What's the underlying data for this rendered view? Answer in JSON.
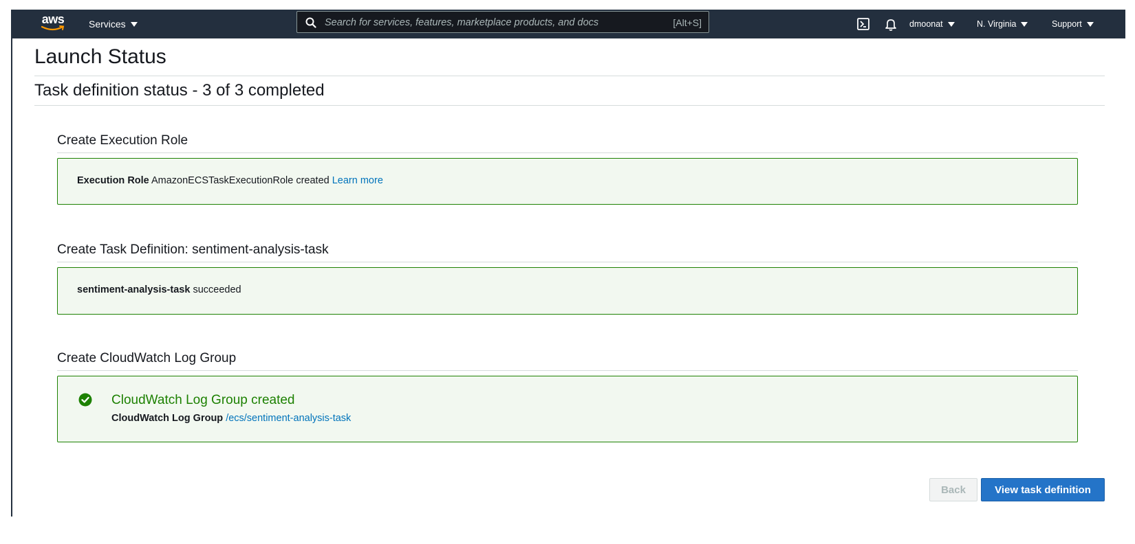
{
  "nav": {
    "logo_text": "aws",
    "services_label": "Services",
    "search_placeholder": "Search for services, features, marketplace products, and docs",
    "search_shortcut": "[Alt+S]",
    "user_label": "dmoonat",
    "region_label": "N. Virginia",
    "support_label": "Support",
    "icons": [
      "cloudshell-icon",
      "bell-icon",
      "search-icon",
      "caret-down-icon"
    ]
  },
  "page": {
    "title": "Launch Status",
    "subtitle": "Task definition status - 3 of 3 completed"
  },
  "sections": [
    {
      "title": "Create Execution Role",
      "label": "Execution Role",
      "text": "AmazonECSTaskExecutionRole created",
      "link": "Learn more"
    },
    {
      "title": "Create Task Definition: sentiment-analysis-task",
      "label": "sentiment-analysis-task",
      "text": "succeeded"
    },
    {
      "title": "Create CloudWatch Log Group",
      "success_title": "CloudWatch Log Group created",
      "label": "CloudWatch Log Group",
      "link": "/ecs/sentiment-analysis-task",
      "icon": "check-circle-icon"
    }
  ],
  "actions": {
    "back_label": "Back",
    "primary_label": "View task definition"
  },
  "colors": {
    "nav_bg": "#232f3e",
    "success": "#1d8102",
    "link": "#0073bb",
    "primary_button": "#2474c8"
  }
}
